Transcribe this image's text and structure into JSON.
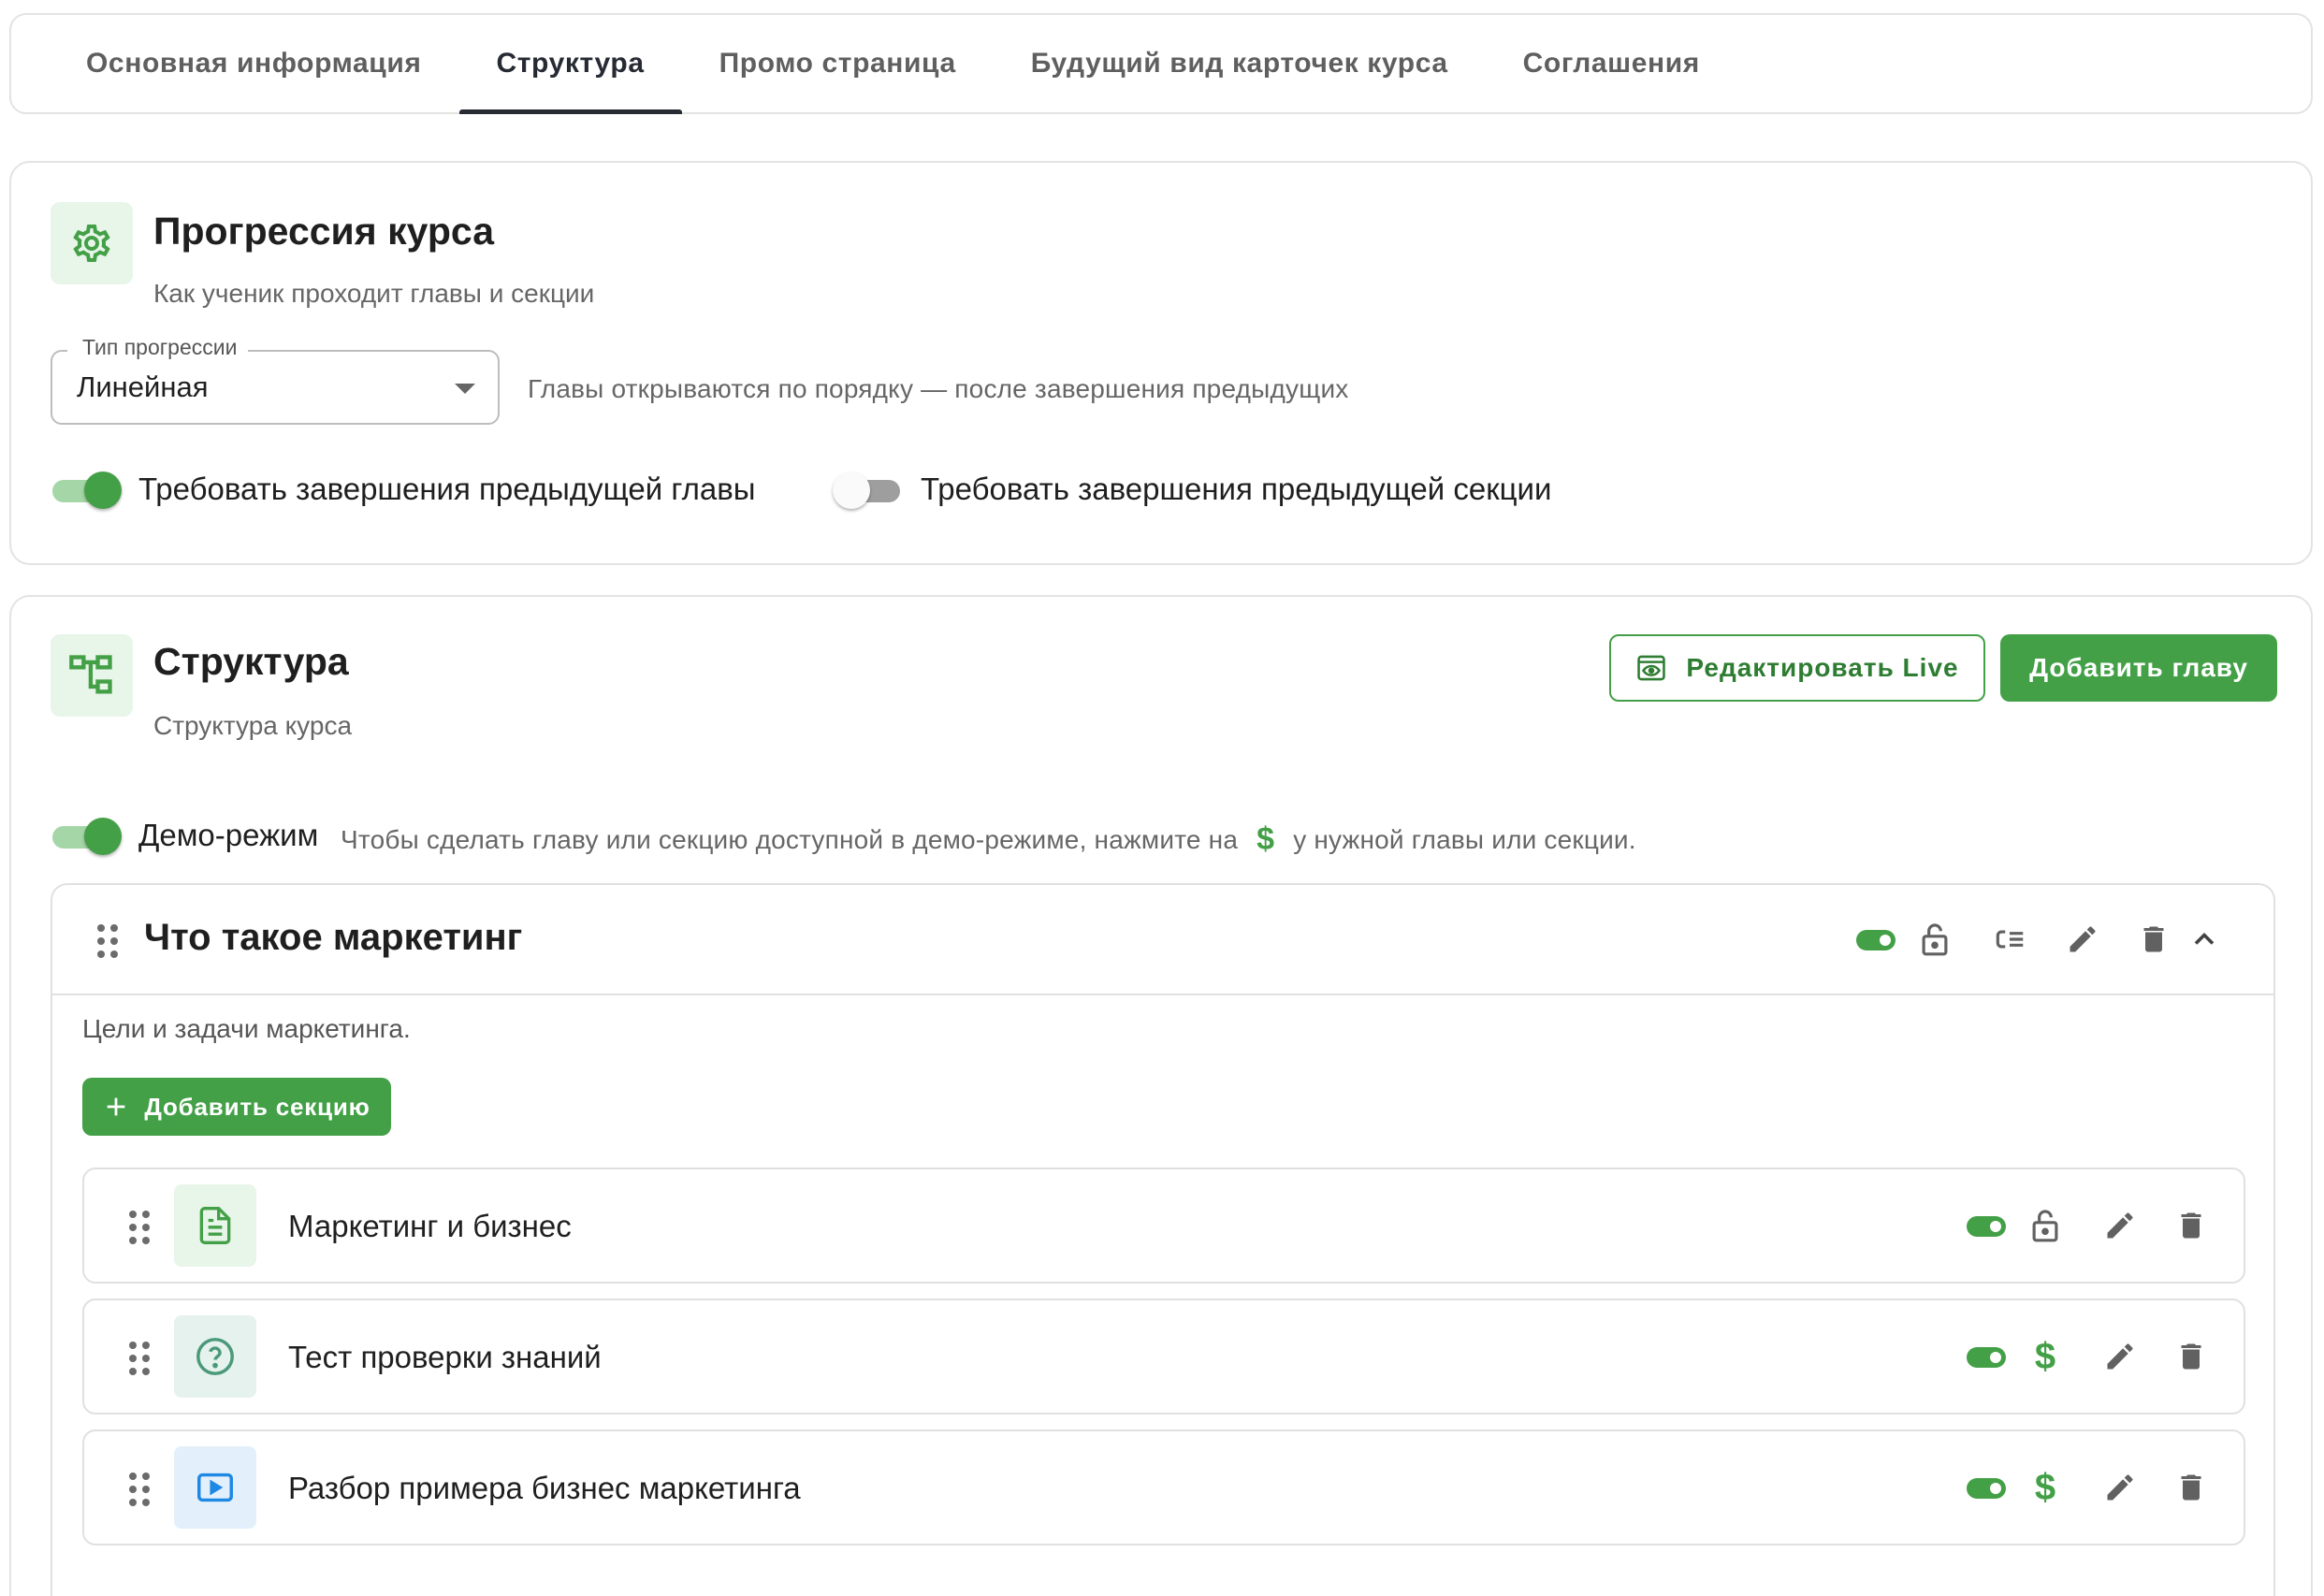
{
  "tabs": [
    {
      "label": "Основная информация",
      "active": false
    },
    {
      "label": "Структура",
      "active": true
    },
    {
      "label": "Промо страница",
      "active": false
    },
    {
      "label": "Будущий вид карточек курса",
      "active": false
    },
    {
      "label": "Соглашения",
      "active": false
    }
  ],
  "progression": {
    "icon": "gear-icon",
    "title": "Прогрессия курса",
    "subtitle": "Как ученик проходит главы и секции",
    "type_label": "Тип прогрессии",
    "type_value": "Линейная",
    "type_hint": "Главы открываются по порядку — после завершения предыдущих",
    "require_chapter_label": "Требовать завершения предыдущей главы",
    "require_chapter_on": true,
    "require_section_label": "Требовать завершения предыдущей секции",
    "require_section_on": false
  },
  "structure": {
    "icon": "structure-tree-icon",
    "title": "Структура",
    "subtitle": "Структура курса",
    "edit_live_label": "Редактировать Live",
    "add_chapter_label": "Добавить главу",
    "demo_label": "Демо-режим",
    "demo_on": true,
    "demo_hint_before": "Чтобы сделать главу или секцию доступной в демо-режиме, нажмите на",
    "demo_hint_after": "у нужной главы или секции.",
    "chapters": [
      {
        "title": "Что такое маркетинг",
        "description": "Цели и задачи маркетинга.",
        "add_section_label": "Добавить секцию",
        "sections": [
          {
            "title": "Маркетинг и бизнес",
            "type_icon": "document-icon",
            "access_icon": "unlock-icon"
          },
          {
            "title": "Тест проверки знаний",
            "type_icon": "quiz-icon",
            "access_icon": "dollar-icon"
          },
          {
            "title": "Разбор примера бизнес маркетинга",
            "type_icon": "video-icon",
            "access_icon": "dollar-icon"
          }
        ]
      }
    ]
  },
  "colors": {
    "accent": "#43a047",
    "accent_dark": "#2e7d32",
    "accent_light": "#e8f5e9",
    "video_bg": "#e3effa",
    "video_accent": "#1e88e5"
  }
}
